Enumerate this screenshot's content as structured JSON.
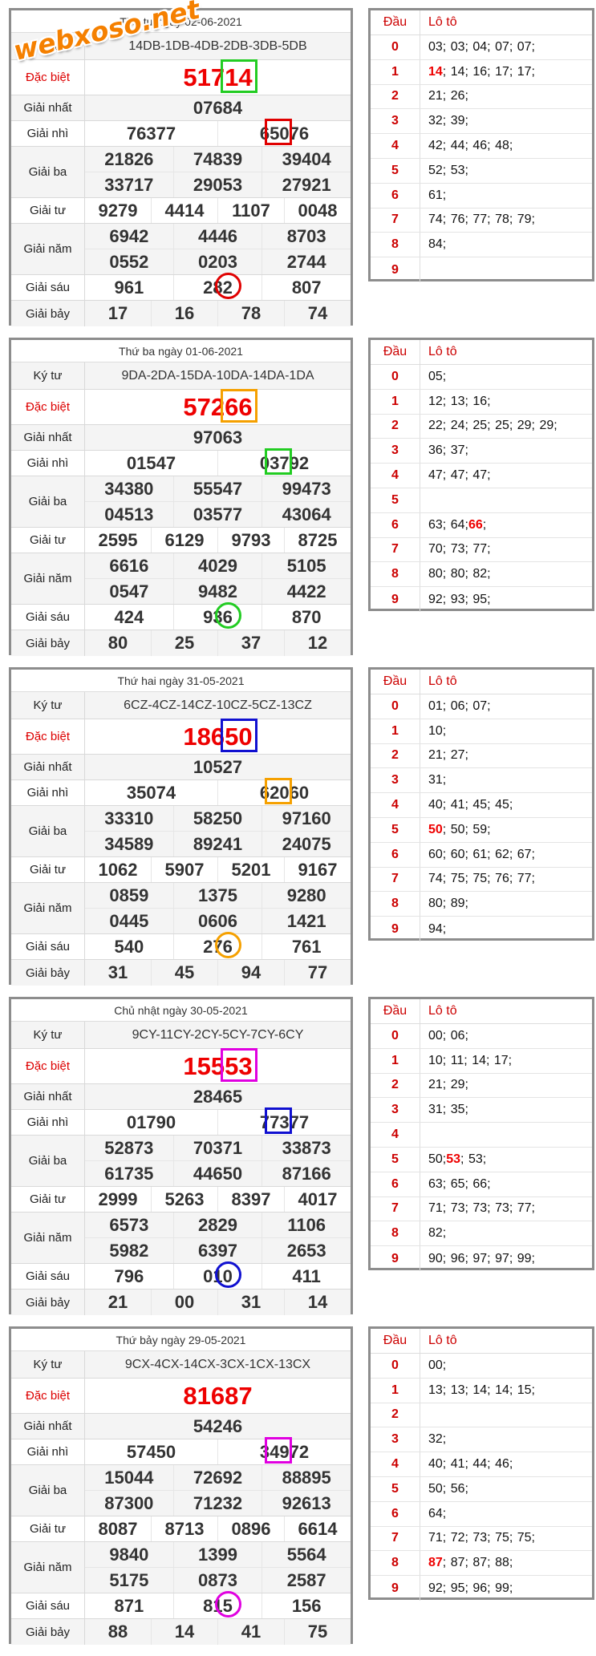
{
  "watermark": "webxoso.net",
  "labels": {
    "ky_tu": "Ký tư",
    "dac_biet": "Đặc biệt",
    "nhat": "Giải nhất",
    "nhi": "Giải nhì",
    "ba": "Giải ba",
    "tu": "Giải tư",
    "nam": "Giải năm",
    "sau": "Giải sáu",
    "bay": "Giải bảy",
    "dau": "Đầu",
    "loto": "Lô tô"
  },
  "days": [
    {
      "date": "Thứ tư ngày 02-06-2021",
      "ky_tu": "14DB-1DB-4DB-2DB-3DB-5DB",
      "dac_biet": "51714",
      "nhat": "07684",
      "nhi": [
        "76377",
        "65076"
      ],
      "ba": [
        [
          "21826",
          "74839",
          "39404"
        ],
        [
          "33717",
          "29053",
          "27921"
        ]
      ],
      "tu": [
        "9279",
        "4414",
        "1107",
        "0048"
      ],
      "nam": [
        [
          "6942",
          "4446",
          "8703"
        ],
        [
          "0552",
          "0203",
          "2744"
        ]
      ],
      "sau": [
        "961",
        "282",
        "807"
      ],
      "bay": [
        "17",
        "16",
        "78",
        "74"
      ],
      "marker_color": "#e00000",
      "special_box_color": "#22cc22",
      "loto": [
        {
          "dau": "0",
          "pre": "",
          "hl": "",
          "post": "03; 03; 04; 07; 07;"
        },
        {
          "dau": "1",
          "pre": "",
          "hl": "14",
          "post": "; 14; 16; 17; 17;"
        },
        {
          "dau": "2",
          "pre": "",
          "hl": "",
          "post": "21; 26;"
        },
        {
          "dau": "3",
          "pre": "",
          "hl": "",
          "post": "32; 39;"
        },
        {
          "dau": "4",
          "pre": "",
          "hl": "",
          "post": "42; 44; 46; 48;"
        },
        {
          "dau": "5",
          "pre": "",
          "hl": "",
          "post": "52; 53;"
        },
        {
          "dau": "6",
          "pre": "",
          "hl": "",
          "post": "61;"
        },
        {
          "dau": "7",
          "pre": "",
          "hl": "",
          "post": "74; 76; 77; 78; 79;"
        },
        {
          "dau": "8",
          "pre": "",
          "hl": "",
          "post": "84;"
        },
        {
          "dau": "9",
          "pre": "",
          "hl": "",
          "post": ""
        }
      ]
    },
    {
      "date": "Thứ ba ngày 01-06-2021",
      "ky_tu": "9DA-2DA-15DA-10DA-14DA-1DA",
      "dac_biet": "57266",
      "nhat": "97063",
      "nhi": [
        "01547",
        "03792"
      ],
      "ba": [
        [
          "34380",
          "55547",
          "99473"
        ],
        [
          "04513",
          "03577",
          "43064"
        ]
      ],
      "tu": [
        "2595",
        "6129",
        "9793",
        "8725"
      ],
      "nam": [
        [
          "6616",
          "4029",
          "5105"
        ],
        [
          "0547",
          "9482",
          "4422"
        ]
      ],
      "sau": [
        "424",
        "936",
        "870"
      ],
      "bay": [
        "80",
        "25",
        "37",
        "12"
      ],
      "marker_color": "#22cc22",
      "special_box_color": "#f5a000",
      "loto": [
        {
          "dau": "0",
          "pre": "",
          "hl": "",
          "post": "05;"
        },
        {
          "dau": "1",
          "pre": "",
          "hl": "",
          "post": "12; 13; 16;"
        },
        {
          "dau": "2",
          "pre": "",
          "hl": "",
          "post": "22; 24; 25; 25; 29; 29;"
        },
        {
          "dau": "3",
          "pre": "",
          "hl": "",
          "post": "36; 37;"
        },
        {
          "dau": "4",
          "pre": "",
          "hl": "",
          "post": "47; 47; 47;"
        },
        {
          "dau": "5",
          "pre": "",
          "hl": "",
          "post": ""
        },
        {
          "dau": "6",
          "pre": "63; 64; ",
          "hl": "66",
          "post": ";"
        },
        {
          "dau": "7",
          "pre": "",
          "hl": "",
          "post": "70; 73; 77;"
        },
        {
          "dau": "8",
          "pre": "",
          "hl": "",
          "post": "80; 80; 82;"
        },
        {
          "dau": "9",
          "pre": "",
          "hl": "",
          "post": "92; 93; 95;"
        }
      ]
    },
    {
      "date": "Thứ hai ngày 31-05-2021",
      "ky_tu": "6CZ-4CZ-14CZ-10CZ-5CZ-13CZ",
      "dac_biet": "18650",
      "nhat": "10527",
      "nhi": [
        "35074",
        "62060"
      ],
      "ba": [
        [
          "33310",
          "58250",
          "97160"
        ],
        [
          "34589",
          "89241",
          "24075"
        ]
      ],
      "tu": [
        "1062",
        "5907",
        "5201",
        "9167"
      ],
      "nam": [
        [
          "0859",
          "1375",
          "9280"
        ],
        [
          "0445",
          "0606",
          "1421"
        ]
      ],
      "sau": [
        "540",
        "276",
        "761"
      ],
      "bay": [
        "31",
        "45",
        "94",
        "77"
      ],
      "marker_color": "#f5a000",
      "special_box_color": "#1010d0",
      "loto": [
        {
          "dau": "0",
          "pre": "",
          "hl": "",
          "post": "01; 06; 07;"
        },
        {
          "dau": "1",
          "pre": "",
          "hl": "",
          "post": "10;"
        },
        {
          "dau": "2",
          "pre": "",
          "hl": "",
          "post": "21; 27;"
        },
        {
          "dau": "3",
          "pre": "",
          "hl": "",
          "post": "31;"
        },
        {
          "dau": "4",
          "pre": "",
          "hl": "",
          "post": "40; 41; 45; 45;"
        },
        {
          "dau": "5",
          "pre": "",
          "hl": "50",
          "post": "; 50; 59;"
        },
        {
          "dau": "6",
          "pre": "",
          "hl": "",
          "post": "60; 60; 61; 62; 67;"
        },
        {
          "dau": "7",
          "pre": "",
          "hl": "",
          "post": "74; 75; 75; 76; 77;"
        },
        {
          "dau": "8",
          "pre": "",
          "hl": "",
          "post": "80; 89;"
        },
        {
          "dau": "9",
          "pre": "",
          "hl": "",
          "post": "94;"
        }
      ]
    },
    {
      "date": "Chủ nhật ngày 30-05-2021",
      "ky_tu": "9CY-11CY-2CY-5CY-7CY-6CY",
      "dac_biet": "15553",
      "nhat": "28465",
      "nhi": [
        "01790",
        "77377"
      ],
      "ba": [
        [
          "52873",
          "70371",
          "33873"
        ],
        [
          "61735",
          "44650",
          "87166"
        ]
      ],
      "tu": [
        "2999",
        "5263",
        "8397",
        "4017"
      ],
      "nam": [
        [
          "6573",
          "2829",
          "1106"
        ],
        [
          "5982",
          "6397",
          "2653"
        ]
      ],
      "sau": [
        "796",
        "010",
        "411"
      ],
      "bay": [
        "21",
        "00",
        "31",
        "14"
      ],
      "marker_color": "#1010d0",
      "special_box_color": "#e000e0",
      "loto": [
        {
          "dau": "0",
          "pre": "",
          "hl": "",
          "post": "00; 06;"
        },
        {
          "dau": "1",
          "pre": "",
          "hl": "",
          "post": "10; 11; 14; 17;"
        },
        {
          "dau": "2",
          "pre": "",
          "hl": "",
          "post": "21; 29;"
        },
        {
          "dau": "3",
          "pre": "",
          "hl": "",
          "post": "31; 35;"
        },
        {
          "dau": "4",
          "pre": "",
          "hl": "",
          "post": ""
        },
        {
          "dau": "5",
          "pre": "50; ",
          "hl": "53",
          "post": "; 53;"
        },
        {
          "dau": "6",
          "pre": "",
          "hl": "",
          "post": "63; 65; 66;"
        },
        {
          "dau": "7",
          "pre": "",
          "hl": "",
          "post": "71; 73; 73; 73; 77;"
        },
        {
          "dau": "8",
          "pre": "",
          "hl": "",
          "post": "82;"
        },
        {
          "dau": "9",
          "pre": "",
          "hl": "",
          "post": "90; 96; 97; 97; 99;"
        }
      ]
    },
    {
      "date": "Thứ bảy ngày 29-05-2021",
      "ky_tu": "9CX-4CX-14CX-3CX-1CX-13CX",
      "dac_biet": "81687",
      "nhat": "54246",
      "nhi": [
        "57450",
        "34972"
      ],
      "ba": [
        [
          "15044",
          "72692",
          "88895"
        ],
        [
          "87300",
          "71232",
          "92613"
        ]
      ],
      "tu": [
        "8087",
        "8713",
        "0896",
        "6614"
      ],
      "nam": [
        [
          "9840",
          "1399",
          "5564"
        ],
        [
          "5175",
          "0873",
          "2587"
        ]
      ],
      "sau": [
        "871",
        "815",
        "156"
      ],
      "bay": [
        "88",
        "14",
        "41",
        "75"
      ],
      "marker_color": "#e000e0",
      "special_box_color": "",
      "loto": [
        {
          "dau": "0",
          "pre": "",
          "hl": "",
          "post": "00;"
        },
        {
          "dau": "1",
          "pre": "",
          "hl": "",
          "post": "13; 13; 14; 14; 15;"
        },
        {
          "dau": "2",
          "pre": "",
          "hl": "",
          "post": ""
        },
        {
          "dau": "3",
          "pre": "",
          "hl": "",
          "post": "32;"
        },
        {
          "dau": "4",
          "pre": "",
          "hl": "",
          "post": "40; 41; 44; 46;"
        },
        {
          "dau": "5",
          "pre": "",
          "hl": "",
          "post": "50; 56;"
        },
        {
          "dau": "6",
          "pre": "",
          "hl": "",
          "post": "64;"
        },
        {
          "dau": "7",
          "pre": "",
          "hl": "",
          "post": "71; 72; 73; 75; 75;"
        },
        {
          "dau": "8",
          "pre": "",
          "hl": "87",
          "post": "; 87; 87; 88;"
        },
        {
          "dau": "9",
          "pre": "",
          "hl": "",
          "post": "92; 95; 96; 99;"
        }
      ]
    }
  ]
}
